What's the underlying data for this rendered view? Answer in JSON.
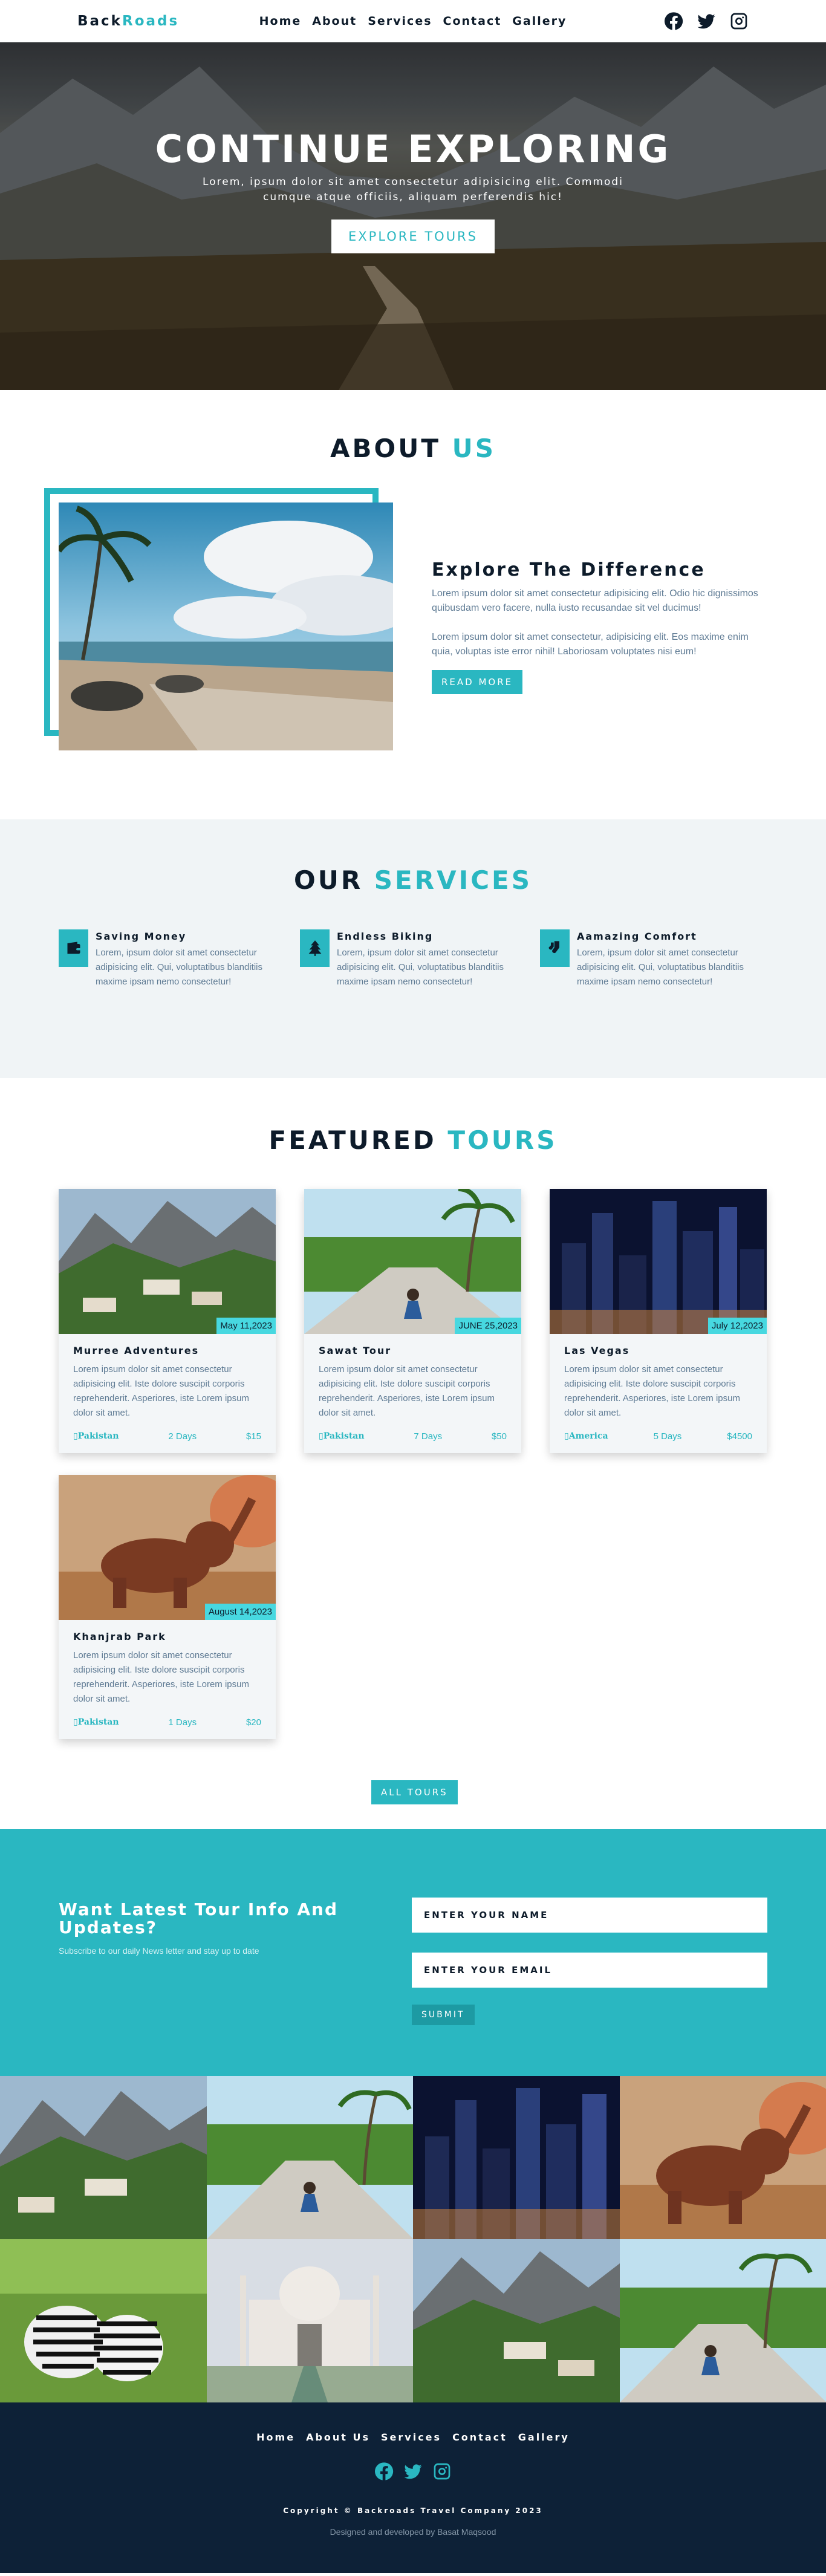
{
  "nav": {
    "logo_a": "Back",
    "logo_b": "Roads",
    "links": [
      "Home",
      "About",
      "Services",
      "Contact",
      "Gallery"
    ],
    "icons": [
      "facebook-icon",
      "twitter-icon",
      "instagram-icon"
    ]
  },
  "hero": {
    "title": "CONTINUE EXPLORING",
    "subtitle": "Lorem, ipsum dolor sit amet consectetur adipisicing elit. Commodi cumque atque officiis, aliquam perferendis hic!",
    "button": "EXPLORE TOURS"
  },
  "about": {
    "title_a": "ABOUT",
    "title_b": "US",
    "heading": "Explore The Difference",
    "p1": "Lorem ipsum dolor sit amet consectetur adipisicing elit. Odio hic dignissimos quibusdam vero facere, nulla iusto recusandae sit vel ducimus!",
    "p2": "Lorem ipsum dolor sit amet consectetur, adipisicing elit. Eos maxime enim quia, voluptas iste error nihil! Laboriosam voluptates nisi eum!",
    "button": "READ MORE"
  },
  "services": {
    "title_a": "OUR",
    "title_b": "SERVICES",
    "items": [
      {
        "icon": "wallet-icon",
        "title": "Saving Money",
        "text": "Lorem, ipsum dolor sit amet consectetur adipisicing elit. Qui, voluptatibus blanditiis maxime ipsam nemo consectetur!"
      },
      {
        "icon": "tree-icon",
        "title": "Endless Biking",
        "text": "Lorem, ipsum dolor sit amet consectetur adipisicing elit. Qui, voluptatibus blanditiis maxime ipsam nemo consectetur!"
      },
      {
        "icon": "socks-icon",
        "title": "Aamazing Comfort",
        "text": "Lorem, ipsum dolor sit amet consectetur adipisicing elit. Qui, voluptatibus blanditiis maxime ipsam nemo consectetur!"
      }
    ]
  },
  "tours": {
    "title_a": "FEATURED",
    "title_b": "TOURS",
    "cards": [
      {
        "date": "May 11,2023",
        "title": "Murree Adventures",
        "text": "Lorem ipsum dolor sit amet consectetur adipisicing elit. Iste dolore suscipit corporis reprehenderit. Asperiores, iste Lorem ipsum dolor sit amet.",
        "location": "Pakistan",
        "days": "2 Days",
        "price": "$15"
      },
      {
        "date": "JUNE 25,2023",
        "title": "Sawat Tour",
        "text": "Lorem ipsum dolor sit amet consectetur adipisicing elit. Iste dolore suscipit corporis reprehenderit. Asperiores, iste Lorem ipsum dolor sit amet.",
        "location": "Pakistan",
        "days": "7 Days",
        "price": "$50"
      },
      {
        "date": "July 12,2023",
        "title": "Las Vegas",
        "text": "Lorem ipsum dolor sit amet consectetur adipisicing elit. Iste dolore suscipit corporis reprehenderit. Asperiores, iste Lorem ipsum dolor sit amet.",
        "location": "America",
        "days": "5 Days",
        "price": "$4500"
      },
      {
        "date": "August 14,2023",
        "title": "Khanjrab Park",
        "text": "Lorem ipsum dolor sit amet consectetur adipisicing elit. Iste dolore suscipit corporis reprehenderit. Asperiores, iste Lorem ipsum dolor sit amet.",
        "location": "Pakistan",
        "days": "1 Days",
        "price": "$20"
      }
    ],
    "all_button": "ALL TOURS"
  },
  "newsletter": {
    "title": "Want Latest Tour Info And Updates?",
    "subtitle": "Subscribe to our daily News letter and stay up to date",
    "name_placeholder": "ENTER YOUR NAME",
    "email_placeholder": "ENTER YOUR EMAIL",
    "submit": "SUBMIT"
  },
  "footer": {
    "links": [
      "Home",
      "About Us",
      "Services",
      "Contact",
      "Gallery"
    ],
    "copyright": "Copyright © Backroads Travel Company 2023",
    "developer": "Designed and developed by Basat Maqsood"
  },
  "colors": {
    "accent": "#2ab7c1",
    "dark": "#0d1b2a",
    "footer_bg": "#0d2137",
    "muted_text": "#5f7b94",
    "date_badge": "#47d8e0"
  }
}
